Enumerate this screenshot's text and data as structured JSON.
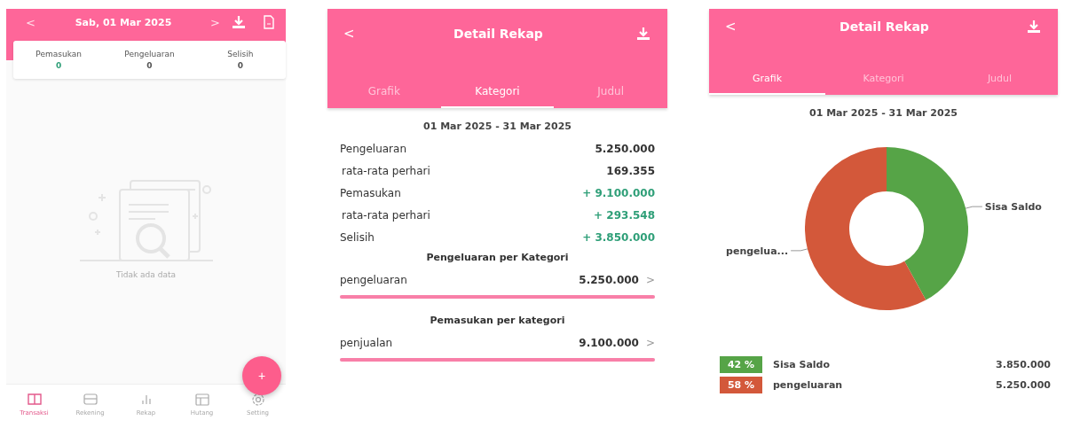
{
  "screens": [
    {
      "kind": "daily",
      "header": {
        "prev": "<",
        "date": "Sab, 01 Mar 2025",
        "next": ">"
      },
      "summary": [
        {
          "label": "Pemasukan",
          "value": "0",
          "positive": true
        },
        {
          "label": "Pengeluaran",
          "value": "0",
          "positive": false
        },
        {
          "label": "Selisih",
          "value": "0",
          "positive": false
        }
      ],
      "empty_text": "Tidak ada data",
      "fab": "+",
      "nav": [
        {
          "label": "Transaksi",
          "selected": true
        },
        {
          "label": "Rekening",
          "selected": false
        },
        {
          "label": "Rekap",
          "selected": false
        },
        {
          "label": "Hutang",
          "selected": false
        },
        {
          "label": "Setting",
          "selected": false
        }
      ]
    },
    {
      "kind": "category",
      "header": {
        "back": "<",
        "title": "Detail Rekap"
      },
      "tabs": [
        {
          "label": "Grafik",
          "selected": false
        },
        {
          "label": "Kategori",
          "selected": true
        },
        {
          "label": "Judul",
          "selected": false
        }
      ],
      "period": "01 Mar 2025 - 31 Mar 2025",
      "rows": [
        {
          "label": "Pengeluaran",
          "value": "5.250.000",
          "sub": false,
          "positive": false
        },
        {
          "label": "rata-rata perhari",
          "value": "169.355",
          "sub": true,
          "positive": false
        },
        {
          "label": "Pemasukan",
          "value": "+ 9.100.000",
          "sub": false,
          "positive": true
        },
        {
          "label": "rata-rata perhari",
          "value": "+ 293.548",
          "sub": true,
          "positive": true
        },
        {
          "label": "Selisih",
          "value": "+ 3.850.000",
          "sub": false,
          "positive": true
        }
      ],
      "sections": [
        {
          "title": "Pengeluaran per Kategori",
          "items": [
            {
              "label": "pengeluaran",
              "value": "5.250.000",
              "chevron": ">",
              "level": 1
            }
          ]
        },
        {
          "title": "Pemasukan per kategori",
          "items": [
            {
              "label": "penjualan",
              "value": "9.100.000",
              "chevron": ">",
              "level": 1
            }
          ]
        }
      ]
    },
    {
      "kind": "chart",
      "header": {
        "back": "<",
        "title": "Detail Rekap"
      },
      "tabs": [
        {
          "label": "Grafik",
          "selected": true
        },
        {
          "label": "Kategori",
          "selected": false
        },
        {
          "label": "Judul",
          "selected": false
        }
      ],
      "period": "01 Mar 2025 - 31 Mar 2025",
      "chart_data": {
        "type": "donut",
        "categories": [
          "Sisa Saldo",
          "pengelua..."
        ],
        "series": [
          {
            "colors": [
              "#56a447",
              "#d3583a"
            ],
            "values": [
              42,
              58
            ]
          }
        ]
      },
      "legend": [
        {
          "percent": "42 %",
          "label": "Sisa Saldo",
          "value": "3.850.000",
          "color": "#56a447"
        },
        {
          "percent": "58 %",
          "label": "pengeluaran",
          "value": "5.250.000",
          "color": "#d3583a"
        }
      ]
    }
  ]
}
